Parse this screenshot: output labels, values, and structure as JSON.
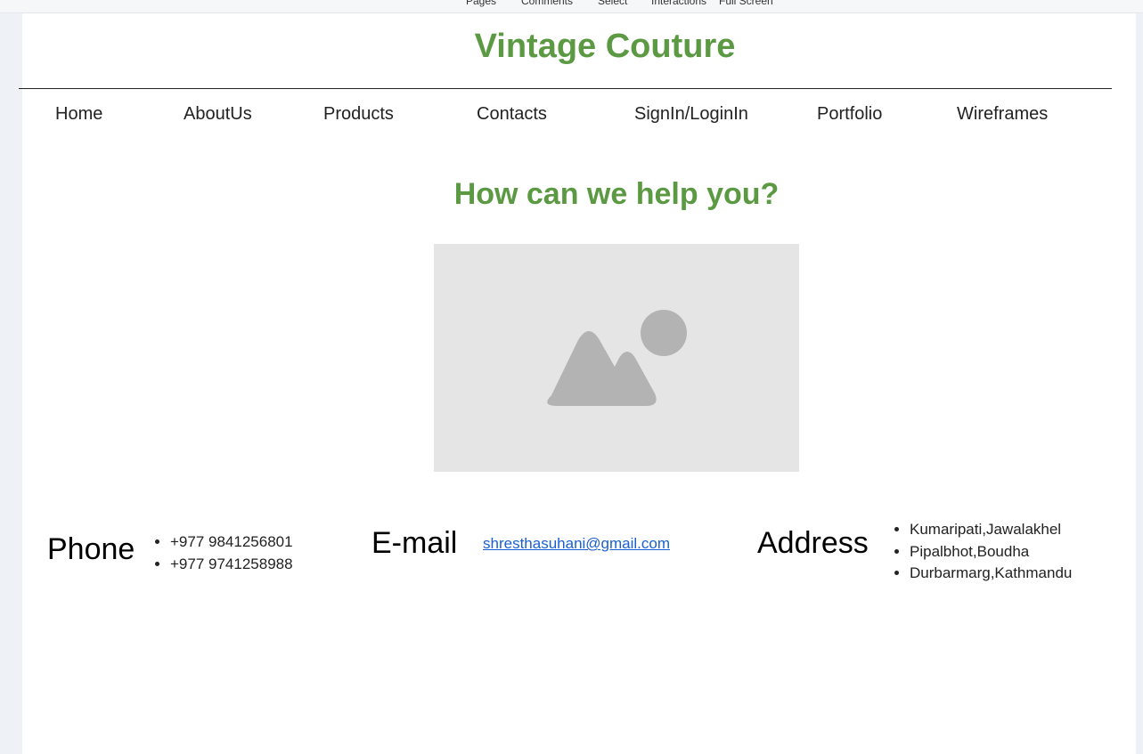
{
  "toolbar": {
    "pages": "Pages",
    "comments": "Comments",
    "select": "Select",
    "interactions": "Interactions",
    "full_screen": "Full Screen"
  },
  "site": {
    "title": "Vintage Couture"
  },
  "nav": {
    "items": [
      {
        "label": "Home"
      },
      {
        "label": "AboutUs"
      },
      {
        "label": "Products"
      },
      {
        "label": "Contacts"
      },
      {
        "label": "SignIn/LoginIn"
      },
      {
        "label": "Portfolio"
      },
      {
        "label": "Wireframes"
      }
    ]
  },
  "main": {
    "heading": "How can we help you?",
    "image_icon": "image-placeholder-icon"
  },
  "contact": {
    "phone_label": "Phone",
    "phones": [
      "+977 9841256801",
      "+977 9741258988"
    ],
    "email_label": "E-mail",
    "email": "shresthasuhani@gmail.com",
    "address_label": "Address",
    "addresses": [
      "Kumaripati,Jawalakhel",
      "Pipalbhot,Boudha",
      "Durbarmarg,Kathmandu"
    ]
  },
  "colors": {
    "brand_green": "#5b9a43",
    "link_blue": "#1a5fd1"
  }
}
